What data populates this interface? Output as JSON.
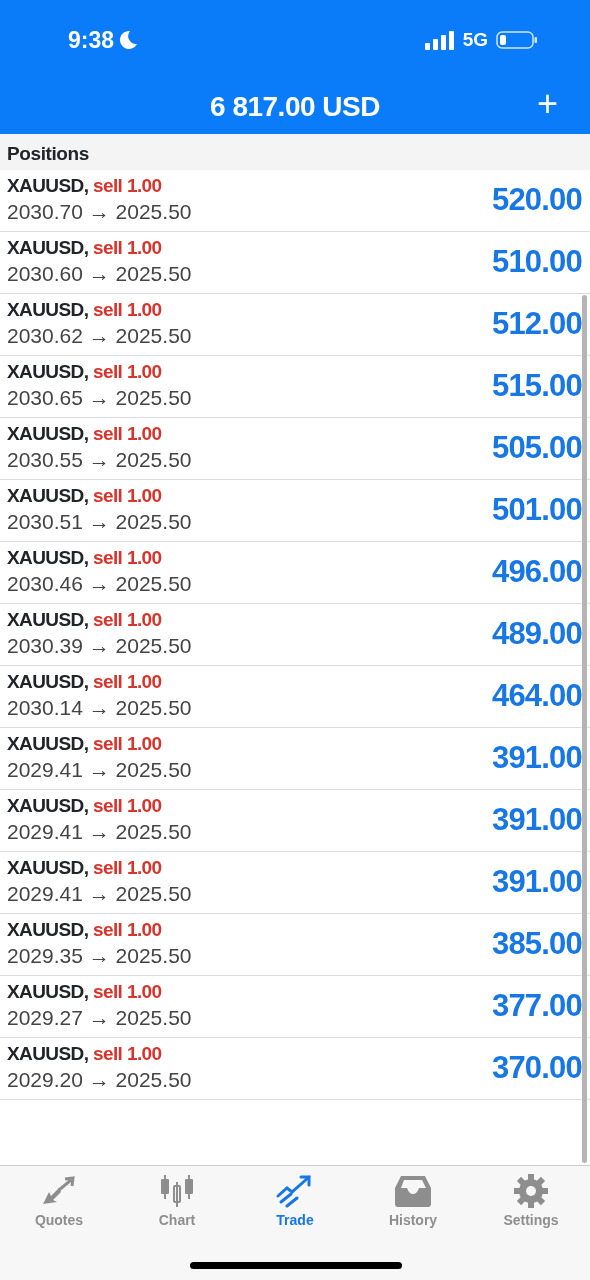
{
  "status_bar": {
    "time": "9:38",
    "network": "5G"
  },
  "header": {
    "title": "6 817.00 USD",
    "add_button": "+"
  },
  "section_title": "Positions",
  "positions": [
    {
      "symbol": "XAUUSD,",
      "side": "sell 1.00",
      "prices": "2030.70 → 2025.50",
      "profit": "520.00"
    },
    {
      "symbol": "XAUUSD,",
      "side": "sell 1.00",
      "prices": "2030.60 → 2025.50",
      "profit": "510.00"
    },
    {
      "symbol": "XAUUSD,",
      "side": "sell 1.00",
      "prices": "2030.62 → 2025.50",
      "profit": "512.00"
    },
    {
      "symbol": "XAUUSD,",
      "side": "sell 1.00",
      "prices": "2030.65 → 2025.50",
      "profit": "515.00"
    },
    {
      "symbol": "XAUUSD,",
      "side": "sell 1.00",
      "prices": "2030.55 → 2025.50",
      "profit": "505.00"
    },
    {
      "symbol": "XAUUSD,",
      "side": "sell 1.00",
      "prices": "2030.51 → 2025.50",
      "profit": "501.00"
    },
    {
      "symbol": "XAUUSD,",
      "side": "sell 1.00",
      "prices": "2030.46 → 2025.50",
      "profit": "496.00"
    },
    {
      "symbol": "XAUUSD,",
      "side": "sell 1.00",
      "prices": "2030.39 → 2025.50",
      "profit": "489.00"
    },
    {
      "symbol": "XAUUSD,",
      "side": "sell 1.00",
      "prices": "2030.14 → 2025.50",
      "profit": "464.00"
    },
    {
      "symbol": "XAUUSD,",
      "side": "sell 1.00",
      "prices": "2029.41 → 2025.50",
      "profit": "391.00"
    },
    {
      "symbol": "XAUUSD,",
      "side": "sell 1.00",
      "prices": "2029.41 → 2025.50",
      "profit": "391.00"
    },
    {
      "symbol": "XAUUSD,",
      "side": "sell 1.00",
      "prices": "2029.41 → 2025.50",
      "profit": "391.00"
    },
    {
      "symbol": "XAUUSD,",
      "side": "sell 1.00",
      "prices": "2029.35 → 2025.50",
      "profit": "385.00"
    },
    {
      "symbol": "XAUUSD,",
      "side": "sell 1.00",
      "prices": "2029.27 → 2025.50",
      "profit": "377.00"
    },
    {
      "symbol": "XAUUSD,",
      "side": "sell 1.00",
      "prices": "2029.20 → 2025.50",
      "profit": "370.00"
    }
  ],
  "tab_bar": [
    {
      "label": "Quotes",
      "kind": "quotes",
      "selected": false
    },
    {
      "label": "Chart",
      "kind": "chart",
      "selected": false
    },
    {
      "label": "Trade",
      "kind": "trade",
      "selected": true
    },
    {
      "label": "History",
      "kind": "history",
      "selected": false
    },
    {
      "label": "Settings",
      "kind": "settings",
      "selected": false
    }
  ]
}
